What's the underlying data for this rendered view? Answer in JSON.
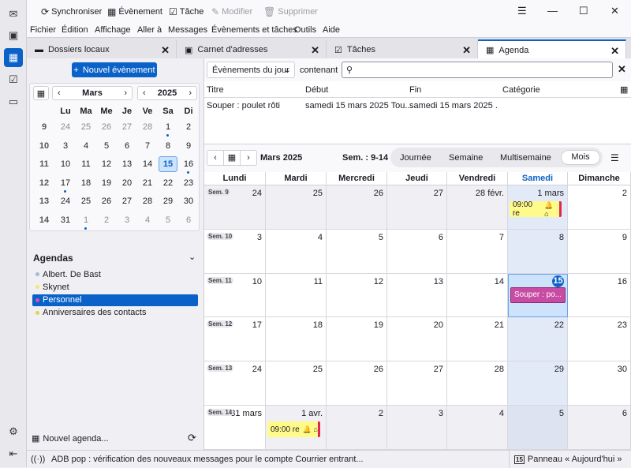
{
  "toolbar": {
    "sync": "Synchroniser",
    "event": "Évènement",
    "task": "Tâche",
    "modify": "Modifier",
    "delete": "Supprimer"
  },
  "menu": [
    "Fichier",
    "Édition",
    "Affichage",
    "Aller à",
    "Messages",
    "Évènements et tâches",
    "Outils",
    "Aide"
  ],
  "tabs": [
    {
      "label": "Dossiers locaux"
    },
    {
      "label": "Carnet d'adresses"
    },
    {
      "label": "Tâches"
    },
    {
      "label": "Agenda"
    }
  ],
  "sidebar": {
    "new_event": "Nouvel évènement",
    "month": "Mars",
    "year": "2025",
    "day_headers": [
      "Lu",
      "Ma",
      "Me",
      "Je",
      "Ve",
      "Sa",
      "Di"
    ],
    "weeks": [
      {
        "wk": "9",
        "days": [
          "24",
          "25",
          "26",
          "27",
          "28",
          "1",
          "2"
        ]
      },
      {
        "wk": "10",
        "days": [
          "3",
          "4",
          "5",
          "6",
          "7",
          "8",
          "9"
        ]
      },
      {
        "wk": "11",
        "days": [
          "10",
          "11",
          "12",
          "13",
          "14",
          "15",
          "16"
        ]
      },
      {
        "wk": "12",
        "days": [
          "17",
          "18",
          "19",
          "20",
          "21",
          "22",
          "23"
        ]
      },
      {
        "wk": "13",
        "days": [
          "24",
          "25",
          "26",
          "27",
          "28",
          "29",
          "30"
        ]
      },
      {
        "wk": "14",
        "days": [
          "31",
          "1",
          "2",
          "3",
          "4",
          "5",
          "6"
        ]
      }
    ],
    "agendas_title": "Agendas",
    "agendas": [
      {
        "name": "Albert. De Bast",
        "color": "#a9b8d8"
      },
      {
        "name": "Skynet",
        "color": "#f5e86a"
      },
      {
        "name": "Personnel",
        "color": "#e04db0"
      },
      {
        "name": "Anniversaires des contacts",
        "color": "#e7d34a"
      }
    ],
    "new_agenda": "Nouvel agenda..."
  },
  "filter": {
    "select": "Évènements du jour",
    "contains": "contenant",
    "search_value": ""
  },
  "list": {
    "headers": [
      "Titre",
      "Début",
      "Fin",
      "Catégorie"
    ],
    "rows": [
      [
        "Souper : poulet rôti",
        "samedi 15 mars 2025 Tou...",
        "samedi 15 mars 2025 ...",
        ""
      ]
    ]
  },
  "view": {
    "title": "Mars 2025",
    "week_range": "Sem. : 9-14",
    "modes": [
      "Journée",
      "Semaine",
      "Multisemaine",
      "Mois"
    ],
    "active_mode": "Mois"
  },
  "month": {
    "headers": [
      "Lundi",
      "Mardi",
      "Mercredi",
      "Jeudi",
      "Vendredi",
      "Samedi",
      "Dimanche"
    ],
    "weeks": [
      {
        "label": "Sem. 9",
        "days": [
          "24",
          "25",
          "26",
          "27",
          "28 févr.",
          "1 mars",
          "2"
        ]
      },
      {
        "label": "Sem. 10",
        "days": [
          "3",
          "4",
          "5",
          "6",
          "7",
          "8",
          "9"
        ]
      },
      {
        "label": "Sem. 11",
        "days": [
          "10",
          "11",
          "12",
          "13",
          "14",
          "15",
          "16"
        ]
      },
      {
        "label": "Sem. 12",
        "days": [
          "17",
          "18",
          "19",
          "20",
          "21",
          "22",
          "23"
        ]
      },
      {
        "label": "Sem. 13",
        "days": [
          "24",
          "25",
          "26",
          "27",
          "28",
          "29",
          "30"
        ]
      },
      {
        "label": "Sem. 14",
        "days": [
          "31 mars",
          "1 avr.",
          "2",
          "3",
          "4",
          "5",
          "6"
        ]
      }
    ],
    "event_bday": "09:00 re",
    "event_supper": "Souper : po..."
  },
  "status": {
    "text": "ADB pop : vérification des nouveaux messages pour le compte Courrier entrant...",
    "today_pane": "Panneau « Aujourd'hui »",
    "today_num": "15"
  }
}
